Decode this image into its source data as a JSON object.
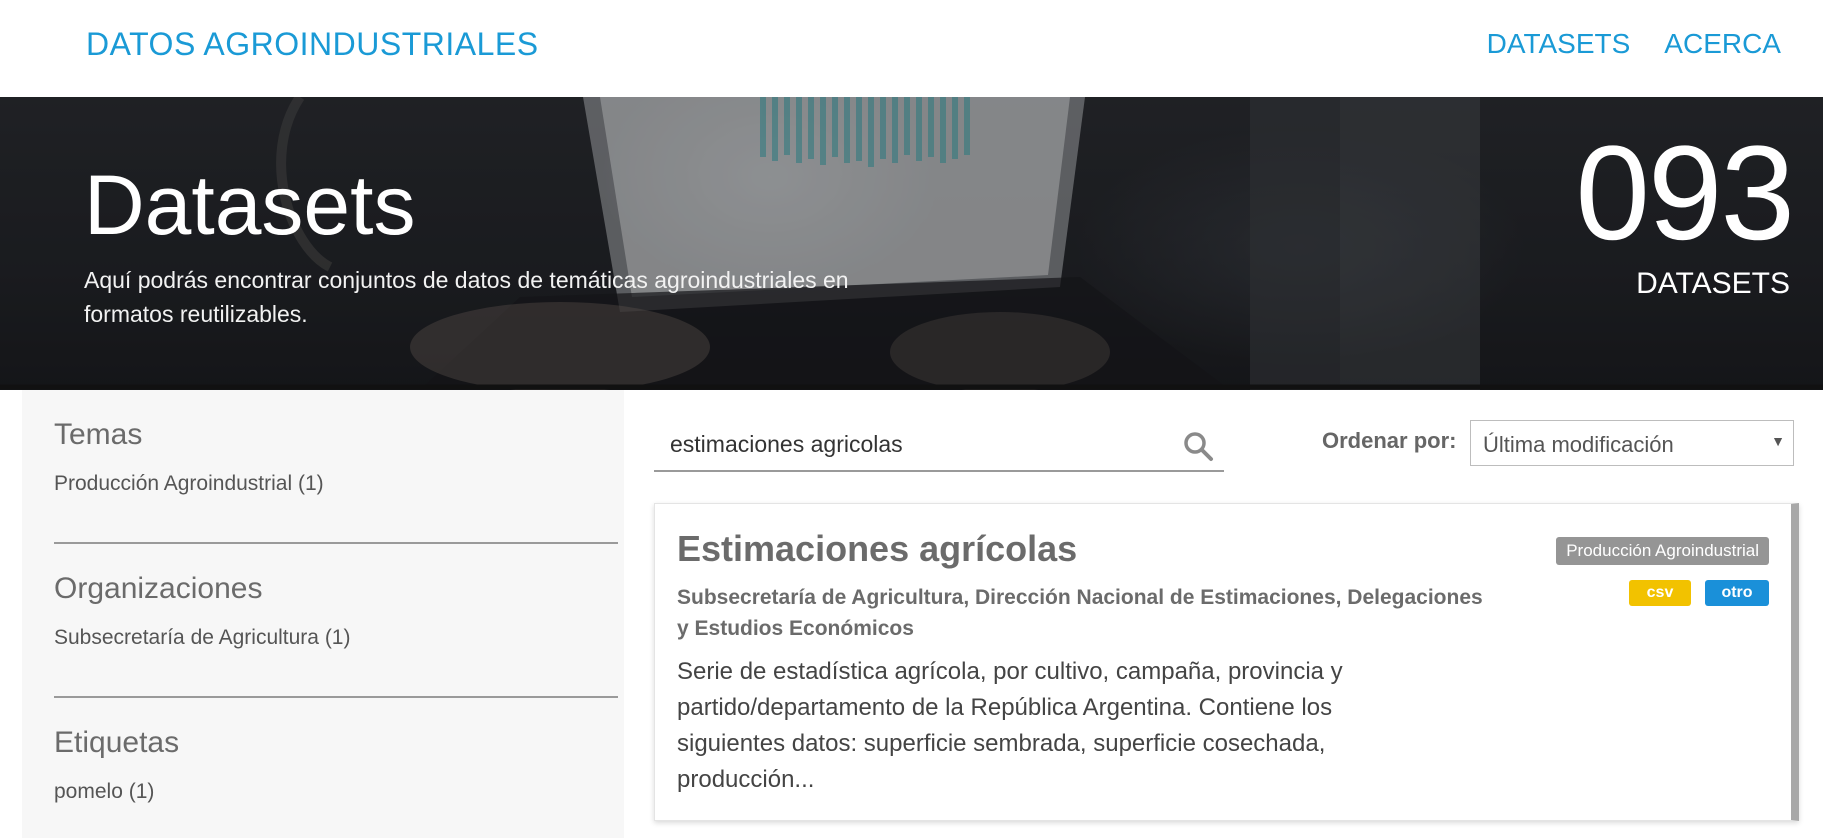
{
  "header": {
    "brand": "DATOS AGROINDUSTRIALES",
    "nav": [
      "DATASETS",
      "ACERCA"
    ],
    "brand_color": "#1a9ad6"
  },
  "hero": {
    "title": "Datasets",
    "subtitle": "Aquí podrás encontrar conjuntos de datos de temáticas agroindustriales en formatos reutilizables.",
    "count": "093",
    "count_label": "DATASETS"
  },
  "sidebar": {
    "sections": [
      {
        "heading": "Temas",
        "items": [
          "Producción Agroindustrial (1)"
        ]
      },
      {
        "heading": "Organizaciones",
        "items": [
          "Subsecretaría de Agricultura (1)"
        ]
      },
      {
        "heading": "Etiquetas",
        "items": [
          "pomelo (1)"
        ]
      }
    ]
  },
  "search": {
    "value": "estimaciones agricolas",
    "icon": "search-icon"
  },
  "order": {
    "label": "Ordenar por:",
    "selected": "Última modificación"
  },
  "results": [
    {
      "title": "Estimaciones agrícolas",
      "organization": "Subsecretaría de Agricultura, Dirección Nacional de Estimaciones, Delegaciones y Estudios Económicos",
      "description": "Serie de estadística agrícola, por cultivo, campaña, provincia y partido/departamento de la República Argentina. Contiene los siguientes datos: superficie sembrada, superficie cosechada, producción...",
      "theme": "Producción Agroindustrial",
      "formats": [
        "csv",
        "otro"
      ],
      "format_colors": {
        "csv": "#f2c200",
        "otro": "#1a90d9"
      }
    }
  ]
}
